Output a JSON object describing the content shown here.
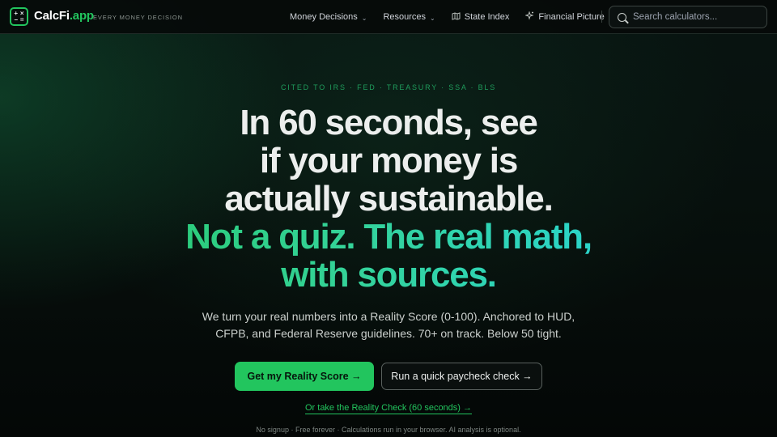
{
  "nav": {
    "brand_name": "CalcFi",
    "brand_tld": ".app",
    "tagline": "EVERY MONEY DECISION",
    "links": [
      {
        "label": "Money Decisions",
        "icon": "chevron-down-icon"
      },
      {
        "label": "Resources",
        "icon": "chevron-down-icon"
      },
      {
        "label": "State Index",
        "icon": "map-icon"
      },
      {
        "label": "Financial Picture",
        "icon": "sparkle-icon"
      }
    ],
    "search_placeholder": "Search calculators..."
  },
  "hero": {
    "eyebrow": "CITED TO IRS · FED · TREASURY · SSA · BLS",
    "headline_lines": [
      "In 60 seconds, see",
      "if your money is",
      "actually sustainable."
    ],
    "headline_accent_lines": [
      "Not a quiz. The real math,",
      "with sources."
    ],
    "subtitle_line1": "We turn your real numbers into a Reality Score (0-100). Anchored to HUD,",
    "subtitle_line2": "CFPB, and Federal Reserve guidelines. 70+ on track. Below 50 tight.",
    "primary_button": "Get my Reality Score →",
    "secondary_button": "Run a quick paycheck check →",
    "reality_check_link": "Or take the Reality Check (60 seconds) →",
    "footnote": "No signup · Free forever · Calculations run in your browser. AI analysis is optional."
  },
  "colors": {
    "accent": "#22c55e",
    "accent_cyan": "#22d3ee",
    "background": "#050908"
  }
}
